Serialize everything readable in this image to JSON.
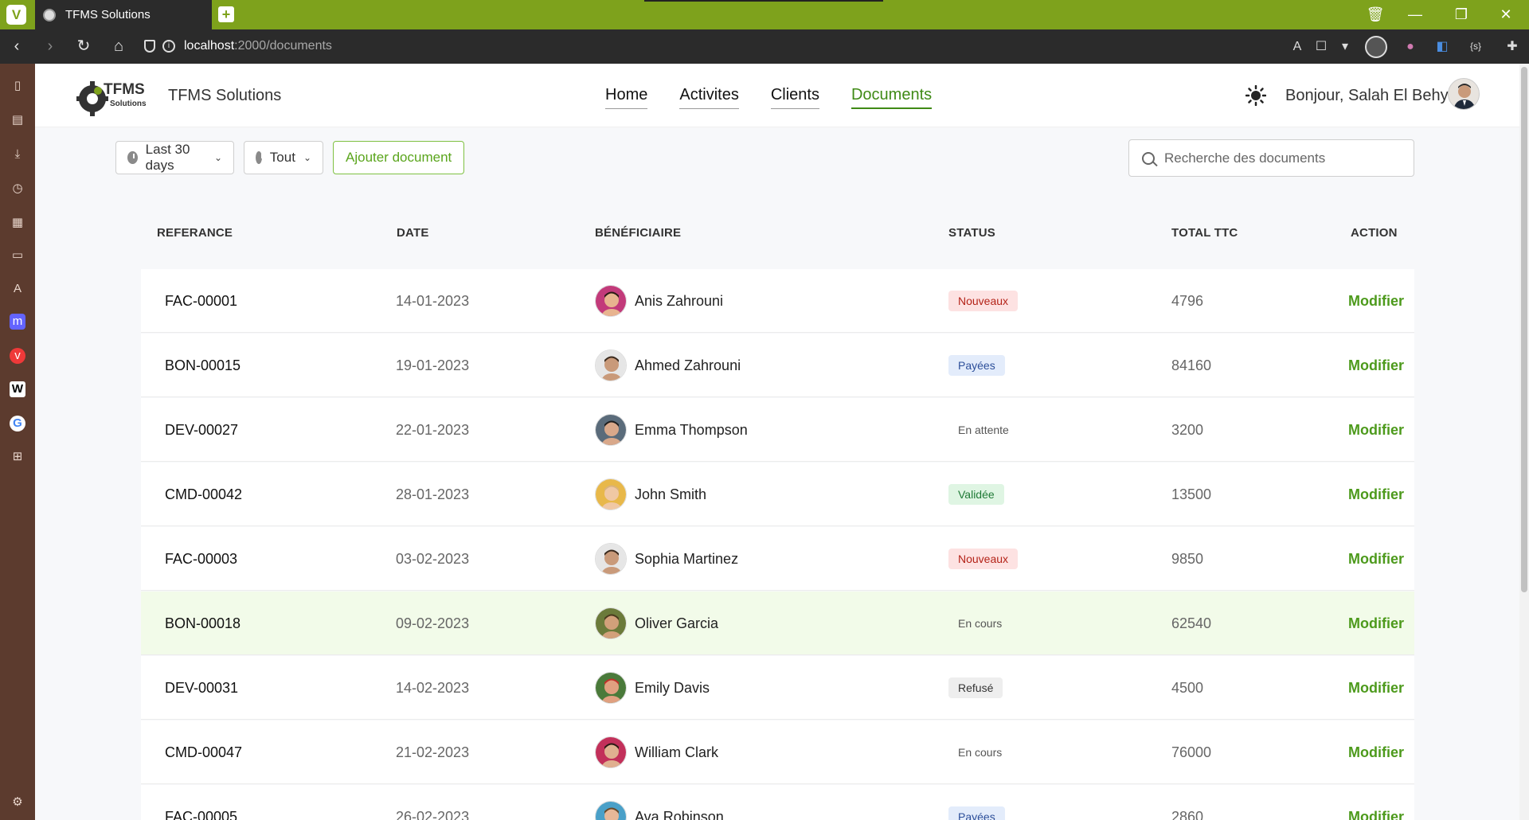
{
  "browser": {
    "tab_title": "TFMS Solutions",
    "url_host": "localhost",
    "url_path": ":2000/documents",
    "logo_letter": "V",
    "new_tab": "+"
  },
  "header": {
    "brand": "TFMS Solutions",
    "logo_text_main": "TFMS",
    "logo_text_sub": "Solutions",
    "nav": [
      {
        "label": "Home"
      },
      {
        "label": "Activites"
      },
      {
        "label": "Clients"
      },
      {
        "label": "Documents"
      }
    ],
    "greeting": "Bonjour, Salah El Behy"
  },
  "toolbar": {
    "period_label": "Last 30 days",
    "filter_label": "Tout",
    "add_label": "Ajouter document",
    "search_placeholder": "Recherche des documents"
  },
  "table": {
    "columns": [
      "REFERANCE",
      "DATE",
      "BÉNÉFICIAIRE",
      "STATUS",
      "TOTAL TTC",
      "ACTION"
    ],
    "rows": [
      {
        "ref": "FAC-00001",
        "date": "14-01-2023",
        "name": "Anis Zahrouni",
        "status": "Nouveaux",
        "total": "4796",
        "action": "Modifier"
      },
      {
        "ref": "BON-00015",
        "date": "19-01-2023",
        "name": "Ahmed Zahrouni",
        "status": "Payées",
        "total": "84160",
        "action": "Modifier"
      },
      {
        "ref": "DEV-00027",
        "date": "22-01-2023",
        "name": "Emma Thompson",
        "status": "En attente",
        "total": "3200",
        "action": "Modifier"
      },
      {
        "ref": "CMD-00042",
        "date": "28-01-2023",
        "name": "John Smith",
        "status": "Validée",
        "total": "13500",
        "action": "Modifier"
      },
      {
        "ref": "FAC-00003",
        "date": "03-02-2023",
        "name": "Sophia Martinez",
        "status": "Nouveaux",
        "total": "9850",
        "action": "Modifier"
      },
      {
        "ref": "BON-00018",
        "date": "09-02-2023",
        "name": "Oliver Garcia",
        "status": "En cours",
        "total": "62540",
        "action": "Modifier"
      },
      {
        "ref": "DEV-00031",
        "date": "14-02-2023",
        "name": "Emily Davis",
        "status": "Refusé",
        "total": "4500",
        "action": "Modifier"
      },
      {
        "ref": "CMD-00047",
        "date": "21-02-2023",
        "name": "William Clark",
        "status": "En cours",
        "total": "76000",
        "action": "Modifier"
      },
      {
        "ref": "FAC-00005",
        "date": "26-02-2023",
        "name": "Ava Robinson",
        "status": "Payées",
        "total": "2860",
        "action": "Modifier"
      }
    ]
  },
  "colors": {
    "accent": "#4d9a1c",
    "titlebar": "#7ea21c",
    "sidepanel": "#5c3b2e",
    "status_nouveaux_bg": "#fde2e2",
    "status_nouveaux_fg": "#b42318",
    "status_payees_bg": "#e3ecfb",
    "status_payees_fg": "#2d4f9a",
    "status_validee_bg": "#dff5e3",
    "status_validee_fg": "#1f7a36",
    "status_refuse_bg": "#eeeeee",
    "status_refuse_fg": "#333333"
  }
}
